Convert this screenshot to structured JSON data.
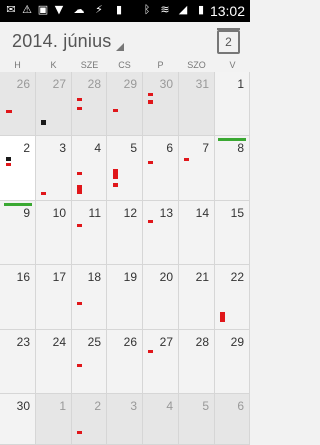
{
  "status_bar": {
    "icons": [
      "sms-icon",
      "warning-icon",
      "image-icon",
      "download-icon",
      "upload-icon",
      "usb-icon",
      "battery-saver-icon",
      "bluetooth-icon",
      "wifi-icon",
      "signal-icon",
      "battery-icon"
    ],
    "time": "13:02"
  },
  "header": {
    "month_title": "2014. június",
    "today_date": "2"
  },
  "weekdays": [
    "H",
    "K",
    "SZE",
    "CS",
    "P",
    "SZO",
    "V"
  ],
  "weeks": [
    [
      {
        "day": "26",
        "state": "out"
      },
      {
        "day": "27",
        "state": "out"
      },
      {
        "day": "28",
        "state": "out"
      },
      {
        "day": "29",
        "state": "out"
      },
      {
        "day": "30",
        "state": "out"
      },
      {
        "day": "31",
        "state": "out"
      },
      {
        "day": "1",
        "state": "in"
      }
    ],
    [
      {
        "day": "2",
        "state": "today"
      },
      {
        "day": "3",
        "state": "in"
      },
      {
        "day": "4",
        "state": "in"
      },
      {
        "day": "5",
        "state": "in"
      },
      {
        "day": "6",
        "state": "in"
      },
      {
        "day": "7",
        "state": "in"
      },
      {
        "day": "8",
        "state": "in"
      }
    ],
    [
      {
        "day": "9",
        "state": "in"
      },
      {
        "day": "10",
        "state": "in"
      },
      {
        "day": "11",
        "state": "in"
      },
      {
        "day": "12",
        "state": "in"
      },
      {
        "day": "13",
        "state": "in"
      },
      {
        "day": "14",
        "state": "in"
      },
      {
        "day": "15",
        "state": "in"
      }
    ],
    [
      {
        "day": "16",
        "state": "in"
      },
      {
        "day": "17",
        "state": "in"
      },
      {
        "day": "18",
        "state": "in"
      },
      {
        "day": "19",
        "state": "in"
      },
      {
        "day": "20",
        "state": "in"
      },
      {
        "day": "21",
        "state": "in"
      },
      {
        "day": "22",
        "state": "in"
      }
    ],
    [
      {
        "day": "23",
        "state": "in"
      },
      {
        "day": "24",
        "state": "in"
      },
      {
        "day": "25",
        "state": "in"
      },
      {
        "day": "26",
        "state": "in"
      },
      {
        "day": "27",
        "state": "in"
      },
      {
        "day": "28",
        "state": "in"
      },
      {
        "day": "29",
        "state": "in"
      }
    ],
    [
      {
        "day": "30",
        "state": "in"
      },
      {
        "day": "1",
        "state": "out"
      },
      {
        "day": "2",
        "state": "out"
      },
      {
        "day": "3",
        "state": "out"
      },
      {
        "day": "4",
        "state": "out"
      },
      {
        "day": "5",
        "state": "out"
      },
      {
        "day": "6",
        "state": "out"
      }
    ]
  ],
  "colors": {
    "event": "#e0161a",
    "event_dark": "#1a1a1a",
    "week_marker": "#3aa832"
  }
}
